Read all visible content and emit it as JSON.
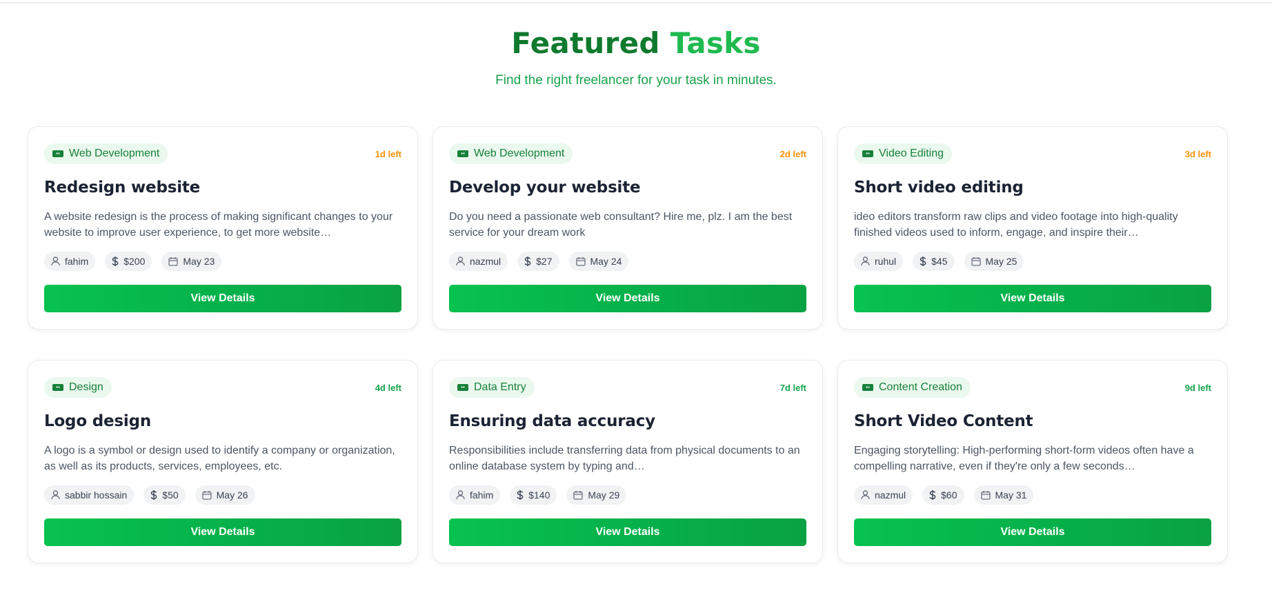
{
  "header": {
    "title_part1": "Featured",
    "title_part2": "Tasks",
    "subtitle": "Find the right freelancer for your task in minutes."
  },
  "colors": {
    "brand_green": "#0f7a2e",
    "accent_green": "#1fba4f",
    "deadline_orange": "#f5930b",
    "deadline_green": "#16a34a"
  },
  "icons": {
    "category": "category-icon",
    "user": "user-icon",
    "budget": "dollar-icon",
    "date": "calendar-icon"
  },
  "tasks": [
    {
      "category": "Web Development",
      "deadline": "1d left",
      "deadline_color": "#f5930b",
      "title": "Redesign website",
      "description": "A website redesign is the process of making significant changes to your website to improve user experience, to get more website…",
      "user": "fahim",
      "budget": "$200",
      "date": "May 23",
      "button": "View Details"
    },
    {
      "category": "Web Development",
      "deadline": "2d left",
      "deadline_color": "#f5930b",
      "title": "Develop your website",
      "description": "Do you need a passionate web consultant? Hire me, plz. I am the best service for your dream work",
      "user": "nazmul",
      "budget": "$27",
      "date": "May 24",
      "button": "View Details"
    },
    {
      "category": "Video Editing",
      "deadline": "3d left",
      "deadline_color": "#f5930b",
      "title": "Short video editing",
      "description": "ideo editors transform raw clips and video footage into high-quality finished videos used to inform, engage, and inspire their…",
      "user": "ruhul",
      "budget": "$45",
      "date": "May 25",
      "button": "View Details"
    },
    {
      "category": "Design",
      "deadline": "4d left",
      "deadline_color": "#16a34a",
      "title": "Logo design",
      "description": "A logo is a symbol or design used to identify a company or organization, as well as its products, services, employees, etc.",
      "user": "sabbir hossain",
      "budget": "$50",
      "date": "May 26",
      "button": "View Details"
    },
    {
      "category": "Data Entry",
      "deadline": "7d left",
      "deadline_color": "#16a34a",
      "title": "Ensuring data accuracy",
      "description": "Responsibilities include transferring data from physical documents to an online database system by typing and…",
      "user": "fahim",
      "budget": "$140",
      "date": "May 29",
      "button": "View Details"
    },
    {
      "category": "Content Creation",
      "deadline": "9d left",
      "deadline_color": "#16a34a",
      "title": "Short Video Content",
      "description": "Engaging storytelling: High-performing short-form videos often have a compelling narrative, even if they're only a few seconds…",
      "user": "nazmul",
      "budget": "$60",
      "date": "May 31",
      "button": "View Details"
    }
  ]
}
